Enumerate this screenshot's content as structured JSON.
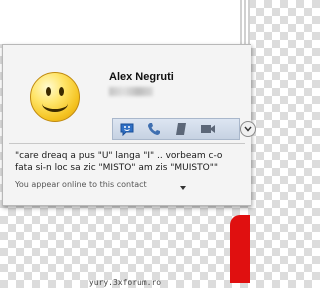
{
  "contact": {
    "name": "Alex Negruti",
    "personal_message_blurred": true
  },
  "toolbar": {
    "icons": [
      "emoticon-icon",
      "call-icon",
      "file-icon",
      "video-icon"
    ],
    "expand_icon": "chevron-down-icon"
  },
  "message": {
    "text": "\"care dreaq a pus \"U\" langa \"I\" .. vorbeam c-o\nfata si-n loc sa zic \"MISTO\" am zis \"MUISTO\"\""
  },
  "status": {
    "text": "You appear online to this contact"
  },
  "watermark": {
    "text": "yury.3xforum.ro"
  },
  "colors": {
    "popup_bg": "#f4f4f4",
    "toolbar_bg": "#c6d2e2",
    "accent_red": "#e01010"
  }
}
